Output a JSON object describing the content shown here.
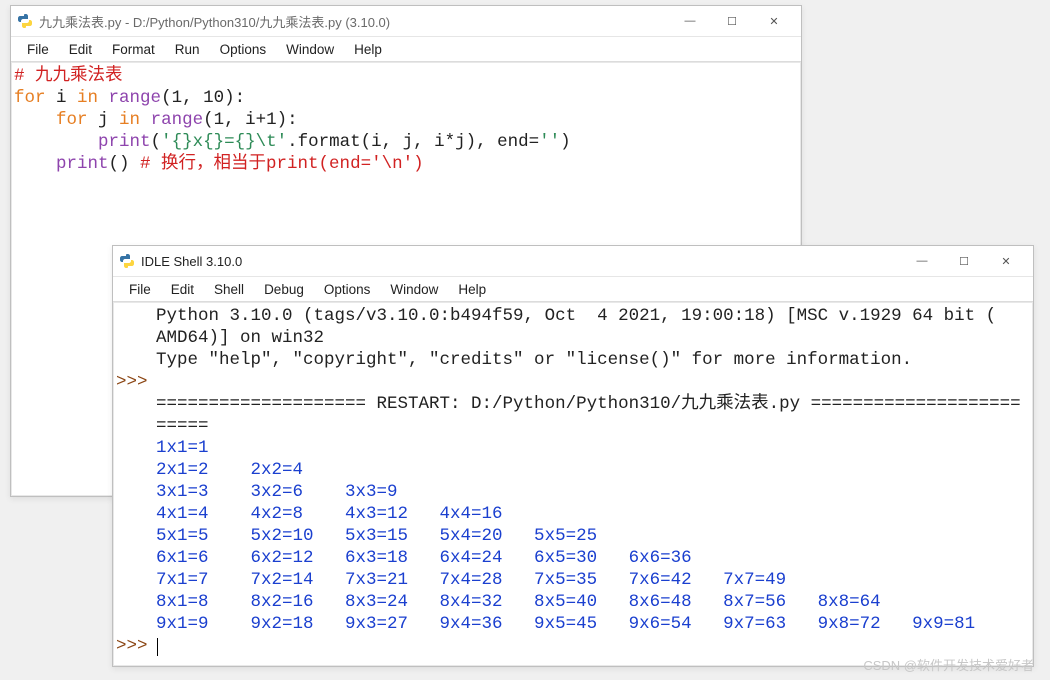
{
  "editor": {
    "title": "九九乘法表.py - D:/Python/Python310/九九乘法表.py (3.10.0)",
    "menu": [
      "File",
      "Edit",
      "Format",
      "Run",
      "Options",
      "Window",
      "Help"
    ],
    "code": {
      "l1_comment": "# 九九乘法表",
      "l2_for": "for",
      "l2_i": " i ",
      "l2_in": "in",
      "l2_range": " range",
      "l2_args": "(1, 10):",
      "l3_indent": "    ",
      "l3_for": "for",
      "l3_j": " j ",
      "l3_in": "in",
      "l3_range": " range",
      "l3_args": "(1, i+1):",
      "l4_indent": "        ",
      "l4_print": "print",
      "l4_open": "(",
      "l4_q1": "'",
      "l4_fmt": "{}x{}={}\\t",
      "l4_q2": "'",
      "l4_dotformat": ".format(i, j, i*j), end=",
      "l4_q3": "''",
      "l4_close": ")",
      "l5_indent": "    ",
      "l5_print": "print",
      "l5_paren": "() ",
      "l5_comment": "# 换行，相当于print(end='\\n')"
    }
  },
  "shell": {
    "title": "IDLE Shell 3.10.0",
    "menu": [
      "File",
      "Edit",
      "Shell",
      "Debug",
      "Options",
      "Window",
      "Help"
    ],
    "banner1": "Python 3.10.0 (tags/v3.10.0:b494f59, Oct  4 2021, 19:00:18) [MSC v.1929 64 bit (",
    "banner2": "AMD64)] on win32",
    "banner3": "Type \"help\", \"copyright\", \"credits\" or \"license()\" for more information.",
    "prompt": ">>>",
    "restart": "==================== RESTART: D:/Python/Python310/九九乘法表.py ====================",
    "restart2": "=====",
    "rows": [
      "1x1=1",
      "2x1=2    2x2=4",
      "3x1=3    3x2=6    3x3=9",
      "4x1=4    4x2=8    4x3=12   4x4=16",
      "5x1=5    5x2=10   5x3=15   5x4=20   5x5=25",
      "6x1=6    6x2=12   6x3=18   6x4=24   6x5=30   6x6=36",
      "7x1=7    7x2=14   7x3=21   7x4=28   7x5=35   7x6=42   7x7=49",
      "8x1=8    8x2=16   8x3=24   8x4=32   8x5=40   8x6=48   8x7=56   8x8=64",
      "9x1=9    9x2=18   9x3=27   9x4=36   9x5=45   9x6=54   9x7=63   9x8=72   9x9=81"
    ]
  },
  "controls": {
    "min": "—",
    "max": "☐",
    "close": "✕"
  },
  "watermark": "CSDN @软件开发技术爱好者"
}
